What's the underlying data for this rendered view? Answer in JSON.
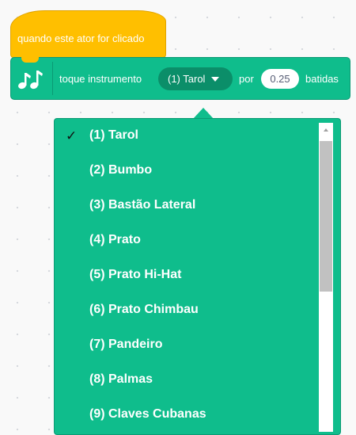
{
  "hat_block": {
    "label": "quando este ator for clicado"
  },
  "music_block": {
    "icon": "music-notes-icon",
    "label_play": "toque instrumento",
    "instrument_selected": "(1) Tarol",
    "label_for": "por",
    "beats_value": "0.25",
    "label_beats": "batidas"
  },
  "instrument_menu": {
    "checkmark": "✓",
    "items": [
      {
        "label": "(1) Tarol",
        "checked": true
      },
      {
        "label": "(2) Bumbo",
        "checked": false
      },
      {
        "label": "(3) Bastão Lateral",
        "checked": false
      },
      {
        "label": "(4) Prato",
        "checked": false
      },
      {
        "label": "(5) Prato Hi-Hat",
        "checked": false
      },
      {
        "label": "(6) Prato Chimbau",
        "checked": false
      },
      {
        "label": "(7) Pandeiro",
        "checked": false
      },
      {
        "label": "(8) Palmas",
        "checked": false
      },
      {
        "label": "(9) Claves Cubanas",
        "checked": false
      }
    ]
  },
  "colors": {
    "events_block": "#ffbf00",
    "music_block": "#0fbd8c",
    "music_block_dark": "#0b8e69",
    "menu_text": "#ffffff"
  }
}
